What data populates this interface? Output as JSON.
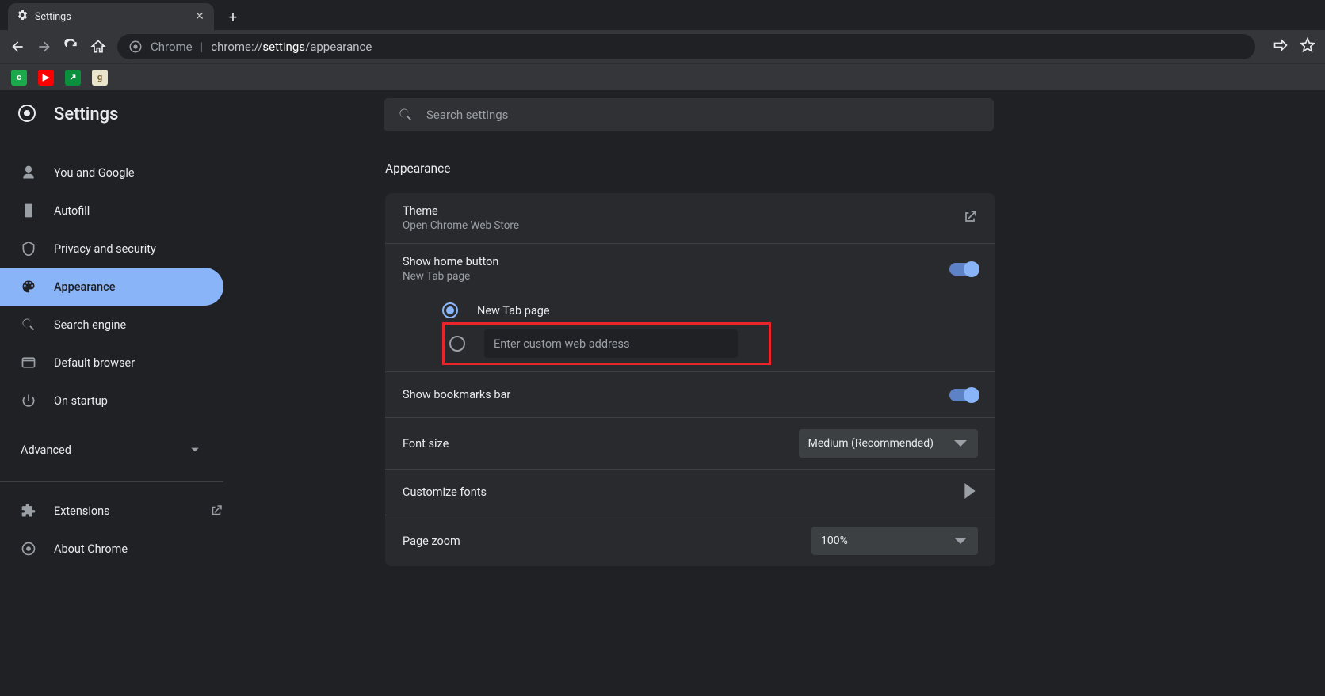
{
  "browser": {
    "tab_title": "Settings",
    "omnibox_prefix": "Chrome",
    "omnibox_url_pre": "chrome://",
    "omnibox_url_bold": "settings",
    "omnibox_url_post": "/appearance"
  },
  "bookmarks": [
    "cb",
    "yt",
    "ex",
    "gr"
  ],
  "app": {
    "title": "Settings",
    "search_placeholder": "Search settings"
  },
  "sidebar": {
    "items": [
      {
        "label": "You and Google"
      },
      {
        "label": "Autofill"
      },
      {
        "label": "Privacy and security"
      },
      {
        "label": "Appearance"
      },
      {
        "label": "Search engine"
      },
      {
        "label": "Default browser"
      },
      {
        "label": "On startup"
      }
    ],
    "advanced": "Advanced",
    "extensions": "Extensions",
    "about": "About Chrome"
  },
  "section_title": "Appearance",
  "theme": {
    "title": "Theme",
    "sub": "Open Chrome Web Store"
  },
  "home": {
    "title": "Show home button",
    "sub": "New Tab page",
    "opt_newtab": "New Tab page",
    "custom_placeholder": "Enter custom web address"
  },
  "bookmarks_bar": {
    "title": "Show bookmarks bar"
  },
  "font_size": {
    "title": "Font size",
    "value": "Medium (Recommended)"
  },
  "customize_fonts": {
    "title": "Customize fonts"
  },
  "page_zoom": {
    "title": "Page zoom",
    "value": "100%"
  }
}
